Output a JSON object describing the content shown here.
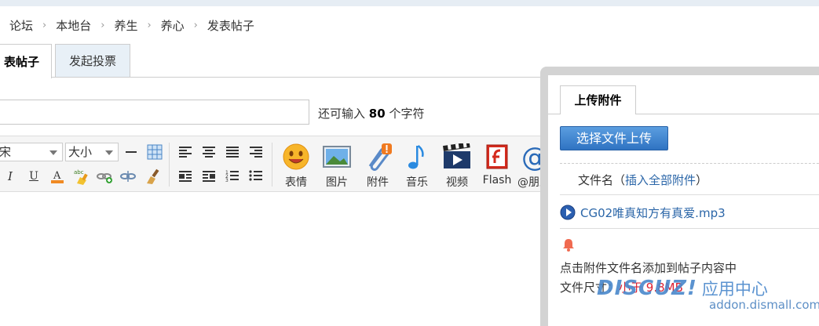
{
  "breadcrumb": [
    "论坛",
    "本地台",
    "养生",
    "养心",
    "发表帖子"
  ],
  "tabs": {
    "active": "表帖子",
    "poll": "发起投票"
  },
  "subject": {
    "value": "",
    "remaining_prefix": "还可输入",
    "remaining_count": "80",
    "remaining_suffix": "个字符"
  },
  "toolbar": {
    "font_select": "宋",
    "size_select": "大小",
    "buttons": [
      "表情",
      "图片",
      "附件",
      "音乐",
      "视频",
      "Flash",
      "@朋友"
    ]
  },
  "attach_panel": {
    "tab": "上传附件",
    "upload_label": "选择文件上传",
    "filename_header": "文件名（",
    "insert_all": "插入全部附件",
    "filename_header_close": "）",
    "file": "CG02唯真知方有真爱.mp3",
    "tip": "点击附件文件名添加到帖子内容中",
    "size_prefix": "文件尺寸：",
    "size_value": "小于 9.8MB"
  },
  "watermark": {
    "brand": "DISCUZ!",
    "center": "应用中心",
    "url": "addon.dismall.com"
  },
  "colors": {
    "link": "#2b66a8",
    "button": "#3a7fcc",
    "panel_frame": "#d3d3d3"
  }
}
